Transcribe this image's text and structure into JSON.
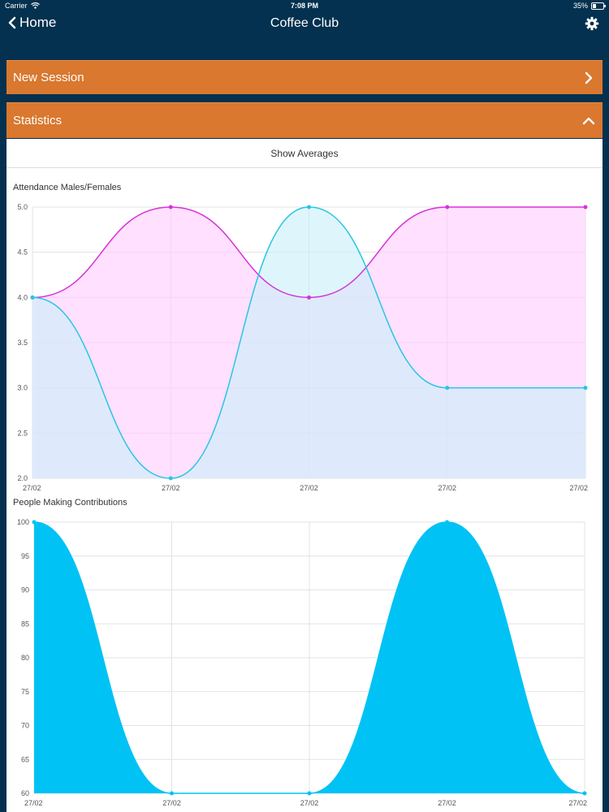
{
  "status": {
    "carrier": "Carrier",
    "time": "7:08 PM",
    "battery": "35%"
  },
  "nav": {
    "back_label": "Home",
    "title": "Coffee Club"
  },
  "sections": {
    "new_session": "New Session",
    "statistics": "Statistics"
  },
  "show_averages": "Show Averages",
  "colors": {
    "navy": "#03314f",
    "orange": "#d9782e",
    "magenta": "#d633d6",
    "cyan": "#29c5e6",
    "bright_cyan": "#00c2f5"
  },
  "chart_data": [
    {
      "type": "area",
      "title": "Attendance Males/Females",
      "categories": [
        "27/02",
        "27/02",
        "27/02",
        "27/02",
        "27/02"
      ],
      "ylim": [
        2.0,
        5.0
      ],
      "yticks": [
        "5.0",
        "4.5",
        "4.0",
        "3.5",
        "3.0",
        "2.5",
        "2.0"
      ],
      "grid": true,
      "series": [
        {
          "values": [
            4,
            5,
            4,
            5,
            5
          ],
          "color": "#d633d6",
          "fill": "#ffccff"
        },
        {
          "values": [
            4,
            2,
            5,
            3,
            3
          ],
          "color": "#29c5e6",
          "fill": "#c8f0f8"
        }
      ]
    },
    {
      "type": "area",
      "title": "People Making Contributions",
      "categories": [
        "27/02",
        "27/02",
        "27/02",
        "27/02",
        "27/02"
      ],
      "ylim": [
        60,
        100
      ],
      "yticks": [
        "100",
        "95",
        "90",
        "85",
        "80",
        "75",
        "70",
        "65",
        "60"
      ],
      "grid": true,
      "series": [
        {
          "values": [
            100,
            60,
            60,
            100,
            60
          ],
          "color": "#00c2f5",
          "fill": "#00c2f5"
        }
      ]
    }
  ]
}
